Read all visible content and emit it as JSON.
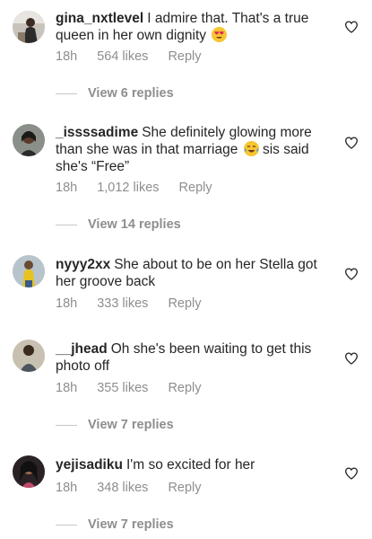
{
  "comments": [
    {
      "username": "gina_nxtlevel",
      "text": "I admire that. That's a true queen in her own  dignity",
      "emoji": "heart-eyes-emoji",
      "time": "18h",
      "likes": "564 likes",
      "reply": "Reply",
      "view_replies": "View 6 replies"
    },
    {
      "username": "_issssadime",
      "text": "She definitely glowing more than she was in that marriage",
      "emoji": "crying-laughing-emoji",
      "text_after": " sis said she's “Free”",
      "time": "18h",
      "likes": "1,012 likes",
      "reply": "Reply",
      "view_replies": "View 14 replies"
    },
    {
      "username": "nyyy2xx",
      "text": "She about to be on her Stella got her groove back",
      "time": "18h",
      "likes": "333 likes",
      "reply": "Reply"
    },
    {
      "username": "__jhead",
      "text": "Oh she's been waiting to get this photo off",
      "time": "18h",
      "likes": "355 likes",
      "reply": "Reply",
      "view_replies": "View 7 replies"
    },
    {
      "username": "yejisadiku",
      "text": "I'm so excited for her",
      "time": "18h",
      "likes": "348 likes",
      "reply": "Reply",
      "view_replies": "View 7 replies"
    }
  ],
  "icons": {
    "like": "heart-outline-icon"
  },
  "colors": {
    "text": "#262626",
    "muted": "#8e8e8e",
    "divider": "#c7c7c7"
  }
}
